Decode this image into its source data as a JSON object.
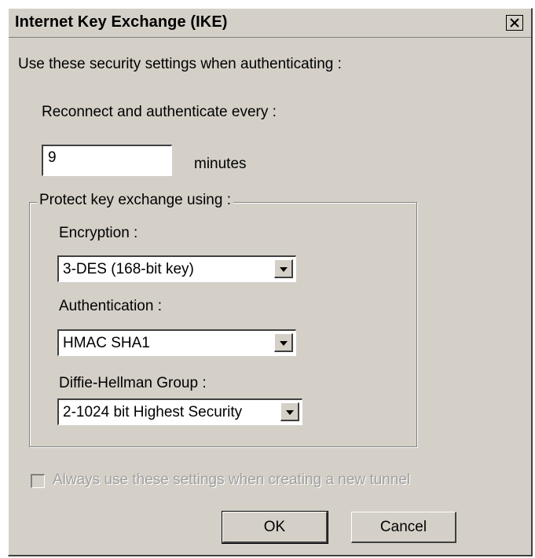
{
  "window": {
    "title": "Internet Key Exchange (IKE)"
  },
  "intro": "Use these security settings when authenticating :",
  "reconnect": {
    "label": "Reconnect and authenticate every :",
    "value": "9",
    "unit": "minutes"
  },
  "group": {
    "label": "Protect key exchange using :",
    "encryption": {
      "label": "Encryption :",
      "selected": "3-DES (168-bit key)"
    },
    "authentication": {
      "label": "Authentication :",
      "selected": "HMAC SHA1"
    },
    "dh_group": {
      "label": "Diffie-Hellman Group :",
      "selected": "2-1024 bit Highest Security"
    }
  },
  "always_use": {
    "label": "Always use these settings when creating a new tunnel",
    "checked": false,
    "enabled": false
  },
  "buttons": {
    "ok": "OK",
    "cancel": "Cancel"
  },
  "icons": {
    "close": "close-icon",
    "dropdown": "chevron-down-icon"
  }
}
